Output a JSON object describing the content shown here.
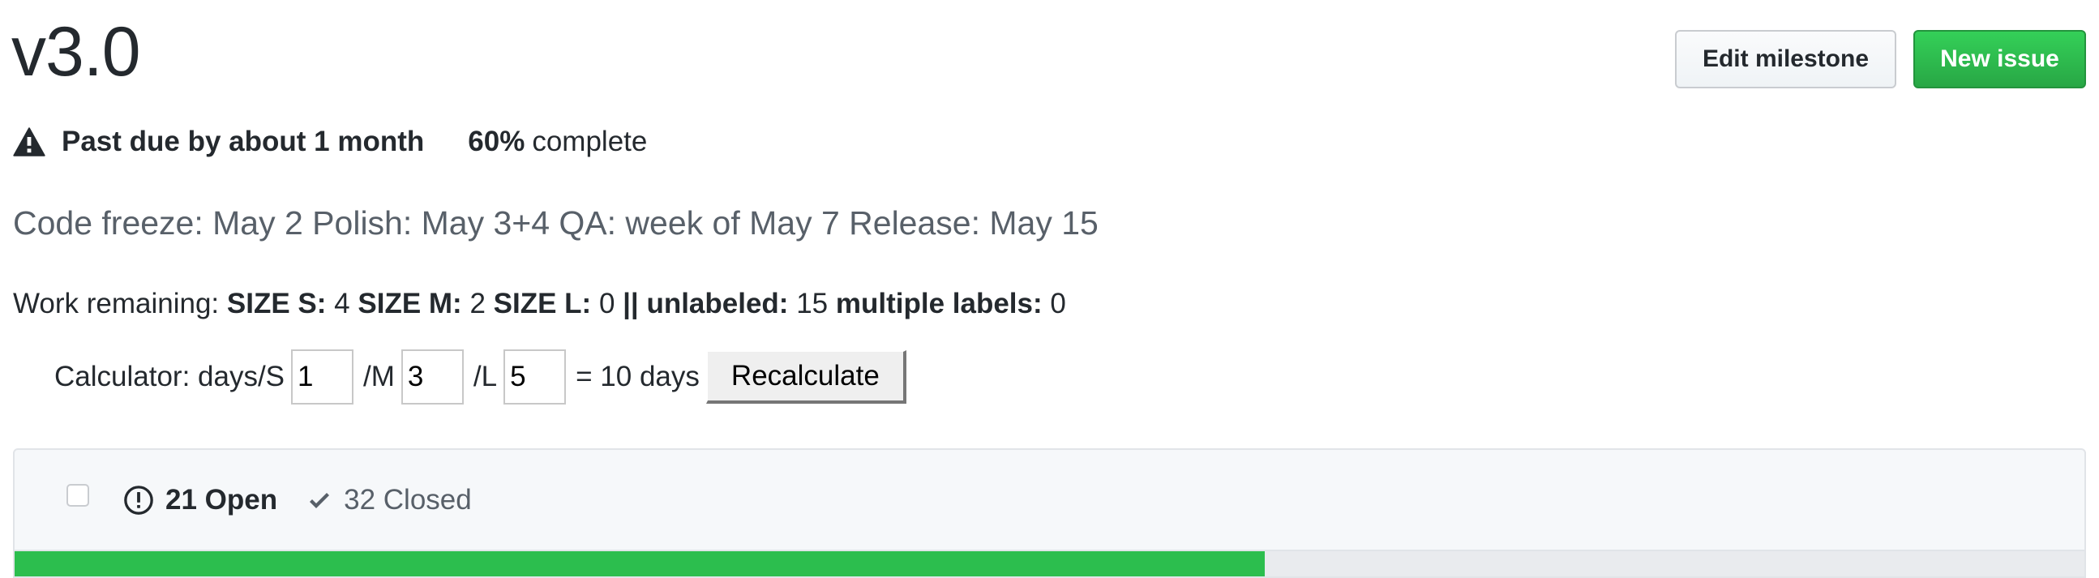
{
  "milestone": {
    "title": "v3.0",
    "status": {
      "icon": "alert-icon",
      "due_text": "Past due by about 1 month",
      "percent_label": "60%",
      "complete_label": "complete",
      "percent_complete": 60.4
    },
    "description": "Code freeze: May 2 Polish: May 3+4 QA: week of May 7 Release: May 15"
  },
  "header_actions": {
    "edit_label": "Edit milestone",
    "new_issue_label": "New issue"
  },
  "colors": {
    "primary_green": "#2cbe4e",
    "muted_text": "#586069",
    "text": "#24292e"
  },
  "work_remaining": {
    "label": "Work remaining:",
    "items": [
      {
        "key": "SIZE S:",
        "value": "4"
      },
      {
        "key": "SIZE M:",
        "value": "2"
      },
      {
        "key": "SIZE L:",
        "value": "0"
      },
      {
        "key": "|| unlabeled:",
        "value": "15"
      },
      {
        "key": "multiple labels:",
        "value": "0"
      }
    ]
  },
  "calculator": {
    "label": "Calculator: days/S",
    "s_value": "1",
    "m_label": "/M",
    "m_value": "3",
    "l_label": "/L",
    "l_value": "5",
    "result": "= 10 days",
    "recalculate_label": "Recalculate"
  },
  "issues": {
    "open_icon": "issue-opened-icon",
    "open_label": "21 Open",
    "closed_icon": "check-icon",
    "closed_label": "32 Closed",
    "open_count": 21,
    "closed_count": 32
  }
}
